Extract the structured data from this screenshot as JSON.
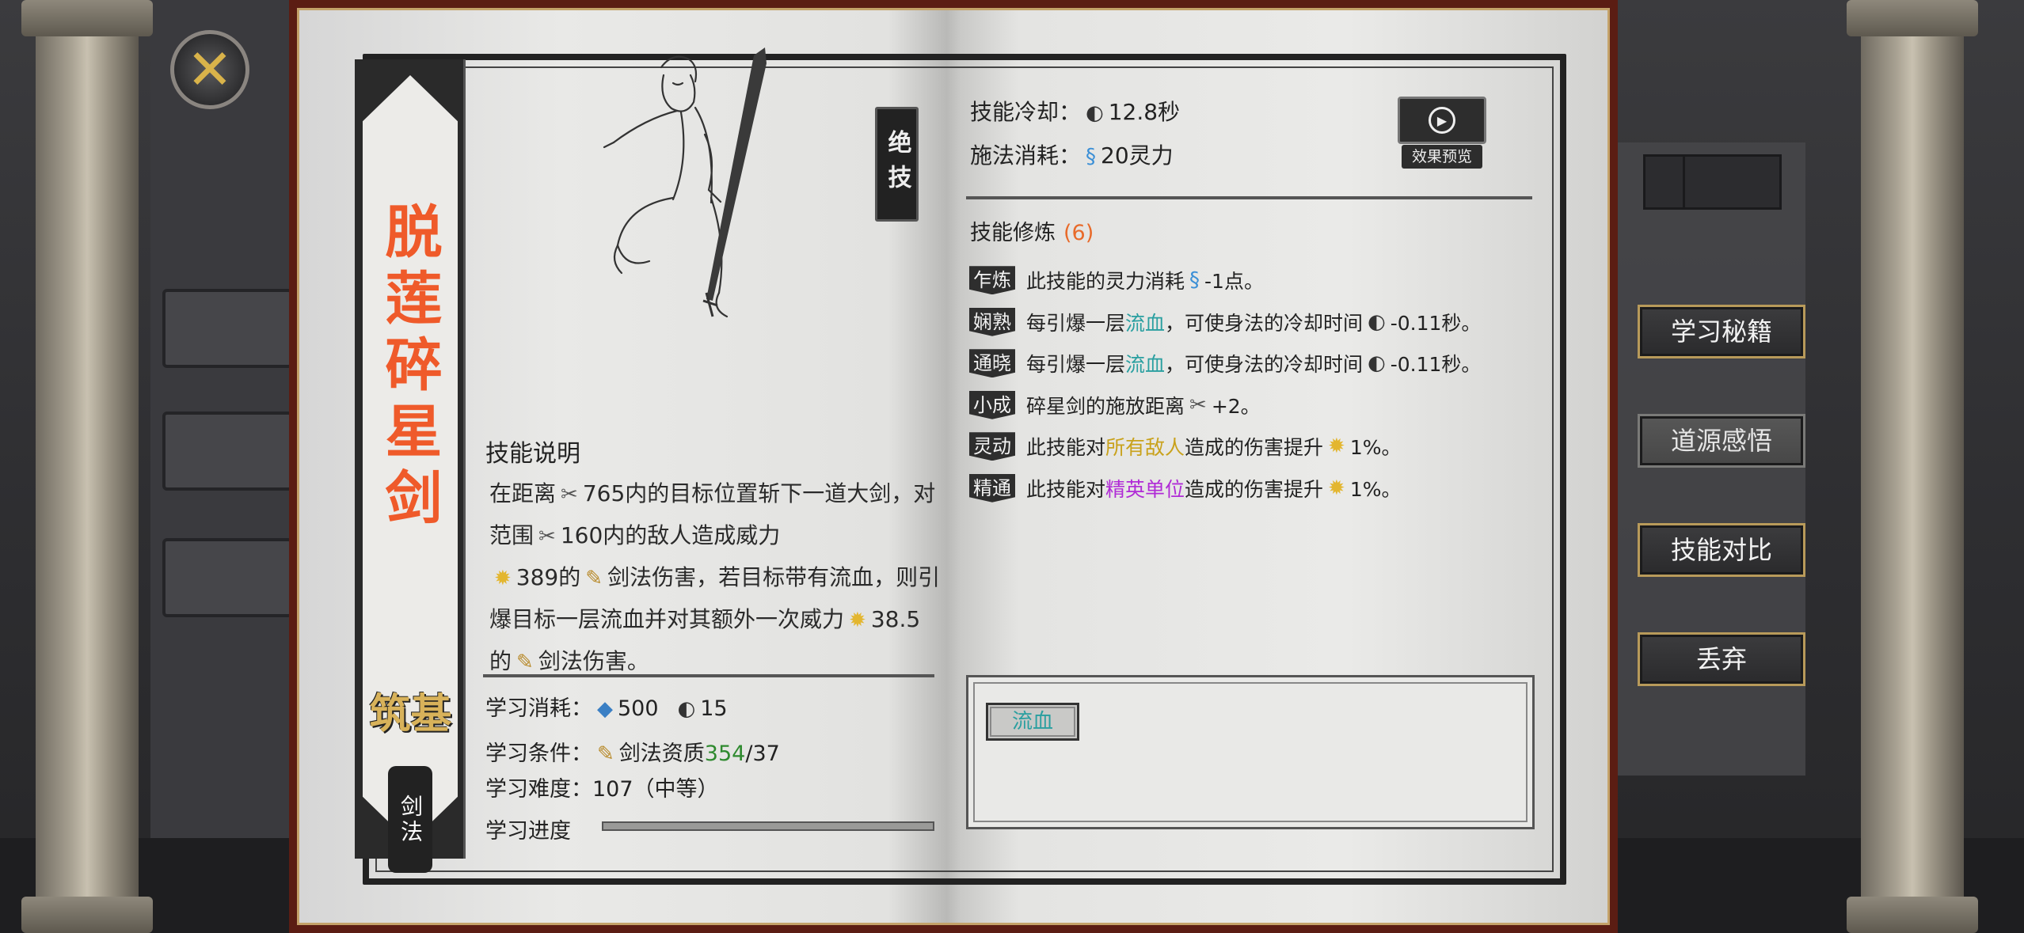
{
  "close_button": {
    "icon": "crossed-swords-icon",
    "glyph": "✕"
  },
  "skill": {
    "name": "脱莲碎星剑",
    "realm": "筑基",
    "category": "剑法",
    "rank": "绝技"
  },
  "description": {
    "title": "技能说明",
    "line1_a": "在距离",
    "range": "765",
    "line1_b": "内的目标位置斩下一道大剑，对范围",
    "radius": "160",
    "line1_c": "内的敌人造成威力",
    "power1": "389",
    "line2_a": "的",
    "line2_b": "剑法伤害，若目标带有流血，则引爆目标一层流血并对其额外一次威力",
    "power2": "38.5",
    "line3_a": "的",
    "line3_b": "剑法伤害。"
  },
  "learning": {
    "cost_label": "学习消耗：",
    "cost_spirit_stone": "500",
    "cost_insight": "15",
    "condition_label": "学习条件：",
    "condition_text": "剑法资质",
    "condition_current": "354",
    "condition_sep": "/",
    "condition_required": "37",
    "difficulty_label": "学习难度：",
    "difficulty_value": "107（中等）",
    "progress_label": "学习进度",
    "progress_fraction": 0
  },
  "stats": {
    "cooldown_label": "技能冷却：",
    "cooldown_value": "12.8秒",
    "cost_label": "施法消耗：",
    "cost_value": "20灵力",
    "preview_label": "效果预览"
  },
  "training": {
    "title": "技能修炼",
    "count": "(6)",
    "items": [
      {
        "tag": "乍炼",
        "a": "此技能的灵力消耗",
        "b": "-1点。"
      },
      {
        "tag": "娴熟",
        "a": "每引爆一层",
        "kw": "流血",
        "b": "，可使身法的冷却时间",
        "c": "-0.11秒。"
      },
      {
        "tag": "通晓",
        "a": "每引爆一层",
        "kw": "流血",
        "b": "，可使身法的冷却时间",
        "c": "-0.11秒。"
      },
      {
        "tag": "小成",
        "a": "碎星剑的施放距离",
        "b": "+2。"
      },
      {
        "tag": "灵动",
        "a": "此技能对",
        "kw": "所有敌人",
        "b": "造成的伤害提升",
        "c": "1%。"
      },
      {
        "tag": "精通",
        "a": "此技能对",
        "kw": "精英单位",
        "b": "造成的伤害提升",
        "c": "1%。"
      }
    ]
  },
  "keywords": {
    "chip": "流血"
  },
  "actions": {
    "learn": "学习秘籍",
    "enlighten": "道源感悟",
    "compare": "技能对比",
    "discard": "丢弃"
  },
  "colors": {
    "title": "#ef5a2a",
    "teal_keyword": "#2a9fa0",
    "yellow_keyword": "#c9a21c",
    "purple_keyword": "#b02bd6",
    "green_value": "#2f8a2f",
    "count_orange": "#e86a2a"
  }
}
